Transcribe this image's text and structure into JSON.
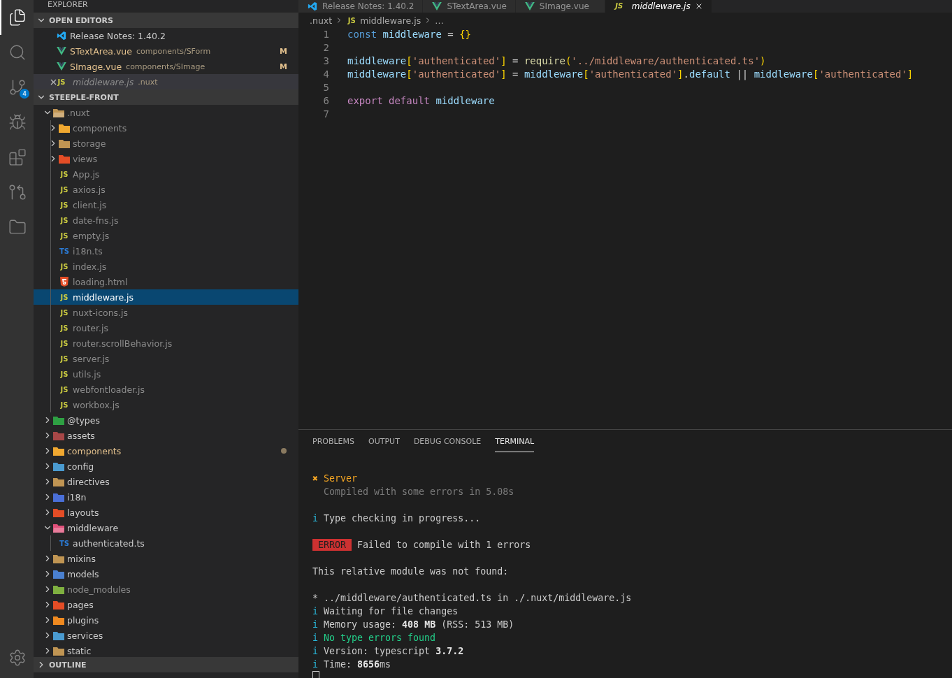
{
  "activity_bar": {
    "items": [
      {
        "kind": "files",
        "selected": true
      },
      {
        "kind": "search",
        "selected": false
      },
      {
        "kind": "scm",
        "selected": false,
        "badge": "4"
      },
      {
        "kind": "debug",
        "selected": false
      },
      {
        "kind": "extensions",
        "selected": false
      },
      {
        "kind": "remote",
        "selected": false
      },
      {
        "kind": "folders",
        "selected": false
      }
    ],
    "bottom": [
      {
        "kind": "settings",
        "selected": false
      }
    ]
  },
  "sidebar": {
    "title": "EXPLORER",
    "open_editors": {
      "title": "OPEN EDITORS",
      "expanded": true,
      "items": [
        {
          "name": "Release Notes: 1.40.2",
          "kind": "vscode",
          "modified": false,
          "preview": false,
          "selected": false
        },
        {
          "name": "STextArea.vue",
          "description": "components/SForm",
          "kind": "vue",
          "modified": true,
          "badge": "M",
          "preview": false,
          "selected": false
        },
        {
          "name": "SImage.vue",
          "description": "components/SImage",
          "kind": "vue",
          "modified": true,
          "badge": "M",
          "preview": false,
          "selected": false
        },
        {
          "name": "middleware.js",
          "description": ".nuxt",
          "kind": "js",
          "icon_label": "JS",
          "modified": false,
          "preview": true,
          "selected": true
        }
      ]
    },
    "project": {
      "title": "STEEPLE-FRONT",
      "expanded": true,
      "tree": [
        {
          "name": ".nuxt",
          "kind": "folder",
          "color": "#c09553",
          "ignored": true,
          "modified": false,
          "expanded": true,
          "selected": false,
          "children": [
            {
              "name": "components",
              "kind": "folder",
              "color": "#f0a830",
              "ignored": true,
              "modified": false,
              "expanded": false,
              "selected": false
            },
            {
              "name": "storage",
              "kind": "folder",
              "color": "#c09553",
              "ignored": true,
              "modified": false,
              "expanded": false,
              "selected": false
            },
            {
              "name": "views",
              "kind": "folder",
              "color": "#e44d26",
              "ignored": true,
              "modified": false,
              "expanded": false,
              "selected": false
            },
            {
              "name": "App.js",
              "kind": "script",
              "icon_label": "JS",
              "color": "#cbcb41",
              "ignored": true,
              "modified": false,
              "selected": false
            },
            {
              "name": "axios.js",
              "kind": "script",
              "icon_label": "JS",
              "color": "#cbcb41",
              "ignored": true,
              "modified": false,
              "selected": false
            },
            {
              "name": "client.js",
              "kind": "script",
              "icon_label": "JS",
              "color": "#cbcb41",
              "ignored": true,
              "modified": false,
              "selected": false
            },
            {
              "name": "date-fns.js",
              "kind": "script",
              "icon_label": "JS",
              "color": "#cbcb41",
              "ignored": true,
              "modified": false,
              "selected": false
            },
            {
              "name": "empty.js",
              "kind": "script",
              "icon_label": "JS",
              "color": "#cbcb41",
              "ignored": true,
              "modified": false,
              "selected": false
            },
            {
              "name": "i18n.ts",
              "kind": "script",
              "icon_label": "TS",
              "color": "#2b7bd6",
              "ignored": true,
              "modified": false,
              "selected": false
            },
            {
              "name": "index.js",
              "kind": "script",
              "icon_label": "JS",
              "color": "#cbcb41",
              "ignored": true,
              "modified": false,
              "selected": false
            },
            {
              "name": "loading.html",
              "kind": "html",
              "color": "#e44d26",
              "ignored": true,
              "modified": false,
              "selected": false
            },
            {
              "name": "middleware.js",
              "kind": "script",
              "icon_label": "JS",
              "color": "#cbcb41",
              "ignored": true,
              "modified": false,
              "selected": true
            },
            {
              "name": "nuxt-icons.js",
              "kind": "script",
              "icon_label": "JS",
              "color": "#cbcb41",
              "ignored": true,
              "modified": false,
              "selected": false
            },
            {
              "name": "router.js",
              "kind": "script",
              "icon_label": "JS",
              "color": "#cbcb41",
              "ignored": true,
              "modified": false,
              "selected": false
            },
            {
              "name": "router.scrollBehavior.js",
              "kind": "script",
              "icon_label": "JS",
              "color": "#cbcb41",
              "ignored": true,
              "modified": false,
              "selected": false
            },
            {
              "name": "server.js",
              "kind": "script",
              "icon_label": "JS",
              "color": "#cbcb41",
              "ignored": true,
              "modified": false,
              "selected": false
            },
            {
              "name": "utils.js",
              "kind": "script",
              "icon_label": "JS",
              "color": "#cbcb41",
              "ignored": true,
              "modified": false,
              "selected": false
            },
            {
              "name": "webfontloader.js",
              "kind": "script",
              "icon_label": "JS",
              "color": "#cbcb41",
              "ignored": true,
              "modified": false,
              "selected": false
            },
            {
              "name": "workbox.js",
              "kind": "script",
              "icon_label": "JS",
              "color": "#cbcb41",
              "ignored": true,
              "modified": false,
              "selected": false
            }
          ]
        },
        {
          "name": "@types",
          "kind": "folder",
          "color": "#2ea043",
          "ignored": false,
          "modified": false,
          "expanded": false,
          "selected": false
        },
        {
          "name": "assets",
          "kind": "folder",
          "color": "#a74747",
          "ignored": false,
          "modified": false,
          "expanded": false,
          "selected": false
        },
        {
          "name": "components",
          "kind": "folder",
          "color": "#f0a830",
          "ignored": false,
          "modified": true,
          "expanded": false,
          "selected": false
        },
        {
          "name": "config",
          "kind": "folder",
          "color": "#4a9bd0",
          "ignored": false,
          "modified": false,
          "expanded": false,
          "selected": false
        },
        {
          "name": "directives",
          "kind": "folder",
          "color": "#c09553",
          "ignored": false,
          "modified": false,
          "expanded": false,
          "selected": false
        },
        {
          "name": "i18n",
          "kind": "folder",
          "color": "#4a6fd8",
          "ignored": false,
          "modified": false,
          "expanded": false,
          "selected": false
        },
        {
          "name": "layouts",
          "kind": "folder",
          "color": "#e44d26",
          "ignored": false,
          "modified": false,
          "expanded": false,
          "selected": false
        },
        {
          "name": "middleware",
          "kind": "folder",
          "color": "#e0507a",
          "ignored": false,
          "modified": false,
          "expanded": true,
          "selected": false,
          "children": [
            {
              "name": "authenticated.ts",
              "kind": "script",
              "icon_label": "TS",
              "color": "#2b7bd6",
              "ignored": false,
              "modified": false,
              "selected": false
            }
          ]
        },
        {
          "name": "mixins",
          "kind": "folder",
          "color": "#c09553",
          "ignored": false,
          "modified": false,
          "expanded": false,
          "selected": false
        },
        {
          "name": "models",
          "kind": "folder",
          "color": "#4a80d0",
          "ignored": false,
          "modified": false,
          "expanded": false,
          "selected": false
        },
        {
          "name": "node_modules",
          "kind": "folder",
          "color": "#7fb040",
          "ignored": true,
          "modified": false,
          "expanded": false,
          "selected": false
        },
        {
          "name": "pages",
          "kind": "folder",
          "color": "#e44d26",
          "ignored": false,
          "modified": false,
          "expanded": false,
          "selected": false
        },
        {
          "name": "plugins",
          "kind": "folder",
          "color": "#f08a20",
          "ignored": false,
          "modified": false,
          "expanded": false,
          "selected": false
        },
        {
          "name": "services",
          "kind": "folder",
          "color": "#4a9bd0",
          "ignored": false,
          "modified": false,
          "expanded": false,
          "selected": false
        },
        {
          "name": "static",
          "kind": "folder",
          "color": "#c09553",
          "ignored": false,
          "modified": false,
          "expanded": false,
          "selected": false
        }
      ]
    },
    "outline": {
      "title": "OUTLINE",
      "expanded": false
    }
  },
  "tabs": [
    {
      "label": "Release Notes: 1.40.2",
      "kind": "vscode",
      "selected": false
    },
    {
      "label": "STextArea.vue",
      "kind": "vue",
      "selected": false
    },
    {
      "label": "SImage.vue",
      "kind": "vue",
      "selected": false
    },
    {
      "label": "middleware.js",
      "kind": "js",
      "icon_label": "JS",
      "selected": true
    }
  ],
  "breadcrumbs": [
    {
      "label": ".nuxt"
    },
    {
      "label": "middleware.js",
      "icon_label": "JS"
    },
    {
      "label": "…"
    }
  ],
  "code": [
    {
      "number": "1",
      "tokens": [
        {
          "t": "const",
          "kind": "keyword"
        },
        {
          "t": " middleware",
          "kind": "var"
        },
        {
          "t": " = "
        },
        {
          "t": "{}",
          "kind": "bracket"
        }
      ]
    },
    {
      "number": "2"
    },
    {
      "number": "3",
      "tokens": [
        {
          "t": "middleware",
          "kind": "var"
        },
        {
          "t": "[",
          "kind": "bracket"
        },
        {
          "t": "'authenticated'",
          "kind": "string"
        },
        {
          "t": "]",
          "kind": "bracket"
        },
        {
          "t": " = "
        },
        {
          "t": "require",
          "kind": "func"
        },
        {
          "t": "(",
          "kind": "bracket"
        },
        {
          "t": "'../middleware/authenticated.ts'",
          "kind": "string"
        },
        {
          "t": ")",
          "kind": "bracket"
        }
      ]
    },
    {
      "number": "4",
      "tokens": [
        {
          "t": "middleware",
          "kind": "var"
        },
        {
          "t": "[",
          "kind": "bracket"
        },
        {
          "t": "'authenticated'",
          "kind": "string"
        },
        {
          "t": "]",
          "kind": "bracket"
        },
        {
          "t": " = "
        },
        {
          "t": "middleware",
          "kind": "var"
        },
        {
          "t": "[",
          "kind": "bracket"
        },
        {
          "t": "'authenticated'",
          "kind": "string"
        },
        {
          "t": "]",
          "kind": "bracket"
        },
        {
          "t": "."
        },
        {
          "t": "default",
          "kind": "var"
        },
        {
          "t": " || "
        },
        {
          "t": "middleware",
          "kind": "var"
        },
        {
          "t": "[",
          "kind": "bracket"
        },
        {
          "t": "'authenticated'",
          "kind": "string"
        },
        {
          "t": "]",
          "kind": "bracket"
        }
      ]
    },
    {
      "number": "5"
    },
    {
      "number": "6",
      "tokens": [
        {
          "t": "export",
          "kind": "control"
        },
        {
          "t": " default",
          "kind": "control"
        },
        {
          "t": " middleware",
          "kind": "var"
        }
      ]
    },
    {
      "number": "7"
    }
  ],
  "panel": {
    "tabs": [
      {
        "label": "PROBLEMS",
        "selected": false
      },
      {
        "label": "OUTPUT",
        "selected": false
      },
      {
        "label": "DEBUG CONSOLE",
        "selected": false
      },
      {
        "label": "TERMINAL",
        "selected": true
      }
    ],
    "terminal": [
      [
        {
          "segments": [
            {
              "t": "✖",
              "kind": "warn"
            },
            {
              "t": " Server",
              "kind": "warn"
            }
          ]
        },
        {
          "indent": true,
          "segments": [
            {
              "t": "Compiled with some errors in 5.08s",
              "kind": "dim"
            }
          ]
        }
      ],
      [
        {
          "segments": [
            {
              "t": "i",
              "kind": "info"
            },
            {
              "t": " Type checking in progress..."
            }
          ]
        }
      ],
      [
        {
          "segments": [
            {
              "t": "ERROR",
              "kind": "badge"
            },
            {
              "t": " Failed to compile with 1 errors"
            }
          ]
        }
      ],
      [
        {
          "segments": [
            {
              "t": "This relative module was not found:"
            }
          ]
        }
      ],
      [
        {
          "segments": [
            {
              "t": "* ../middleware/authenticated.ts in ./.nuxt/middleware.js"
            }
          ]
        },
        {
          "segments": [
            {
              "t": "i",
              "kind": "info"
            },
            {
              "t": " Waiting for file changes"
            }
          ]
        },
        {
          "segments": [
            {
              "t": "i",
              "kind": "info"
            },
            {
              "t": " Memory usage: "
            },
            {
              "t": "408 MB",
              "kind": "bold"
            },
            {
              "t": " (RSS: 513 MB)"
            }
          ]
        },
        {
          "segments": [
            {
              "t": "i",
              "kind": "info"
            },
            {
              "t": " No type errors found",
              "kind": "ok"
            }
          ]
        },
        {
          "segments": [
            {
              "t": "i",
              "kind": "info"
            },
            {
              "t": " Version: typescript "
            },
            {
              "t": "3.7.2",
              "kind": "bold"
            }
          ]
        },
        {
          "segments": [
            {
              "t": "i",
              "kind": "info"
            },
            {
              "t": " Time: "
            },
            {
              "t": "8656",
              "kind": "bold"
            },
            {
              "t": "ms"
            }
          ]
        }
      ]
    ],
    "cursor": true
  }
}
